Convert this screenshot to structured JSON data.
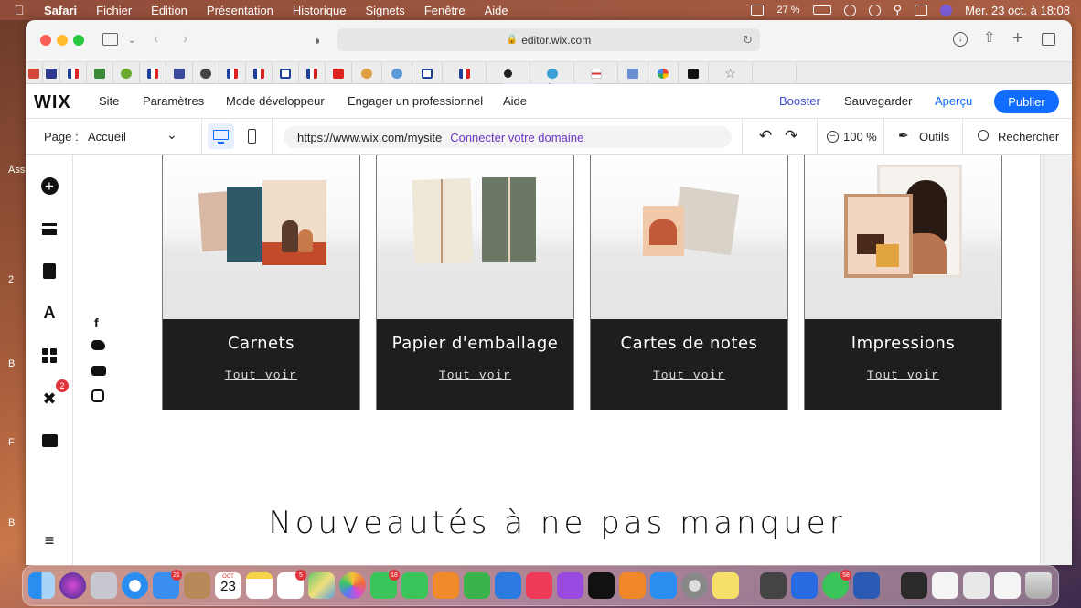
{
  "menubar": {
    "app": "Safari",
    "items": [
      "Fichier",
      "Édition",
      "Présentation",
      "Historique",
      "Signets",
      "Fenêtre",
      "Aide"
    ],
    "battery": "27 %",
    "datetime": "Mer. 23 oct. à  18:08"
  },
  "browser": {
    "url": "editor.wix.com"
  },
  "desktop_side": {
    "labels": [
      "Ass",
      "2",
      "B",
      "F",
      "B"
    ]
  },
  "wix_top": {
    "logo": "WIX",
    "menu": [
      "Site",
      "Paramètres",
      "Mode développeur",
      "Engager un professionnel",
      "Aide"
    ],
    "booster": "Booster",
    "save": "Sauvegarder",
    "preview": "Aperçu",
    "publish": "Publier"
  },
  "wix_page": {
    "page_label": "Page :",
    "page_value": "Accueil",
    "site_url": "https://www.wix.com/mysite",
    "connect_domain": "Connecter votre domaine",
    "zoom": "100 %",
    "tools": "Outils",
    "search": "Rechercher"
  },
  "left_panel": {
    "badge_count": "2"
  },
  "canvas": {
    "categories": [
      {
        "title": "Carnets",
        "link": "Tout voir"
      },
      {
        "title": "Papier d'emballage",
        "link": "Tout voir"
      },
      {
        "title": "Cartes de notes",
        "link": "Tout voir"
      },
      {
        "title": "Impressions",
        "link": "Tout voir"
      }
    ],
    "heading": "Nouveautés à ne pas manquer"
  },
  "dock": {
    "mail_badge": "21",
    "calendar_month": "OCT",
    "calendar_day": "23",
    "reminders_badge": "5",
    "messages_badge": "18",
    "whatsapp_badge": "58"
  }
}
